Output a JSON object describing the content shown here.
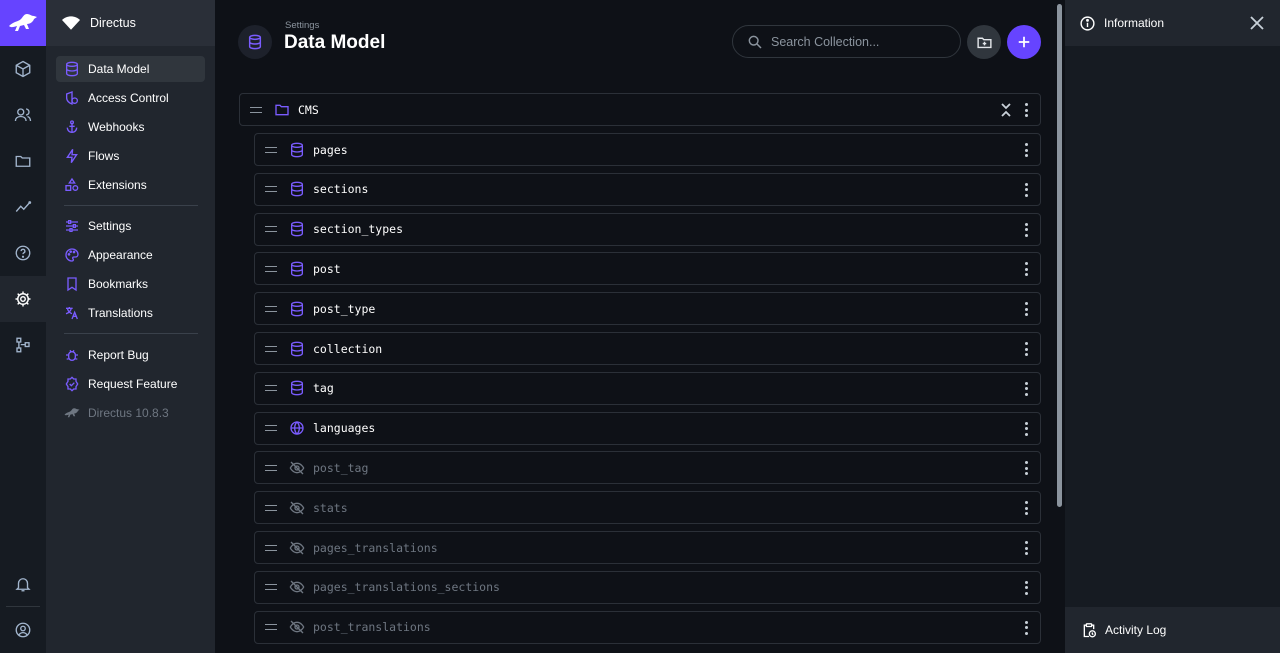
{
  "app": {
    "project_name": "Directus",
    "accent_color": "#6644ff"
  },
  "module_bar": {
    "items": [
      {
        "name": "content-icon"
      },
      {
        "name": "users-icon"
      },
      {
        "name": "files-icon"
      },
      {
        "name": "insights-icon"
      },
      {
        "name": "help-icon"
      },
      {
        "name": "settings-icon",
        "active": true
      },
      {
        "name": "marketplace-icon"
      },
      {
        "name": "notifications-icon"
      },
      {
        "name": "user-account-icon"
      }
    ]
  },
  "nav": {
    "items": [
      {
        "label": "Data Model",
        "icon": "database-icon",
        "active": true
      },
      {
        "label": "Access Control",
        "icon": "access-control-icon"
      },
      {
        "label": "Webhooks",
        "icon": "anchor-icon"
      },
      {
        "label": "Flows",
        "icon": "bolt-icon"
      },
      {
        "label": "Extensions",
        "icon": "extensions-icon"
      },
      {
        "label": "Settings",
        "icon": "sliders-icon"
      },
      {
        "label": "Appearance",
        "icon": "palette-icon"
      },
      {
        "label": "Bookmarks",
        "icon": "bookmark-icon"
      },
      {
        "label": "Translations",
        "icon": "translate-icon"
      },
      {
        "label": "Report Bug",
        "icon": "bug-icon"
      },
      {
        "label": "Request Feature",
        "icon": "verified-icon"
      },
      {
        "label": "Directus 10.8.3",
        "icon": "directus-logo-icon",
        "muted": true
      }
    ]
  },
  "header": {
    "breadcrumb": "Settings",
    "title": "Data Model"
  },
  "search": {
    "placeholder": "Search Collection..."
  },
  "collections": {
    "group": {
      "label": "CMS",
      "icon": "folder-icon"
    },
    "items": [
      {
        "label": "pages",
        "icon": "database-icon",
        "hidden": false
      },
      {
        "label": "sections",
        "icon": "database-icon",
        "hidden": false
      },
      {
        "label": "section_types",
        "icon": "database-icon",
        "hidden": false
      },
      {
        "label": "post",
        "icon": "database-icon",
        "hidden": false
      },
      {
        "label": "post_type",
        "icon": "database-icon",
        "hidden": false
      },
      {
        "label": "collection",
        "icon": "database-icon",
        "hidden": false
      },
      {
        "label": "tag",
        "icon": "database-icon",
        "hidden": false
      },
      {
        "label": "languages",
        "icon": "globe-icon",
        "hidden": false
      },
      {
        "label": "post_tag",
        "icon": "eye-off-icon",
        "hidden": true
      },
      {
        "label": "stats",
        "icon": "eye-off-icon",
        "hidden": true
      },
      {
        "label": "pages_translations",
        "icon": "eye-off-icon",
        "hidden": true
      },
      {
        "label": "pages_translations_sections",
        "icon": "eye-off-icon",
        "hidden": true
      },
      {
        "label": "post_translations",
        "icon": "eye-off-icon",
        "hidden": true
      }
    ]
  },
  "sidebar": {
    "info_label": "Information",
    "activity_label": "Activity Log"
  }
}
